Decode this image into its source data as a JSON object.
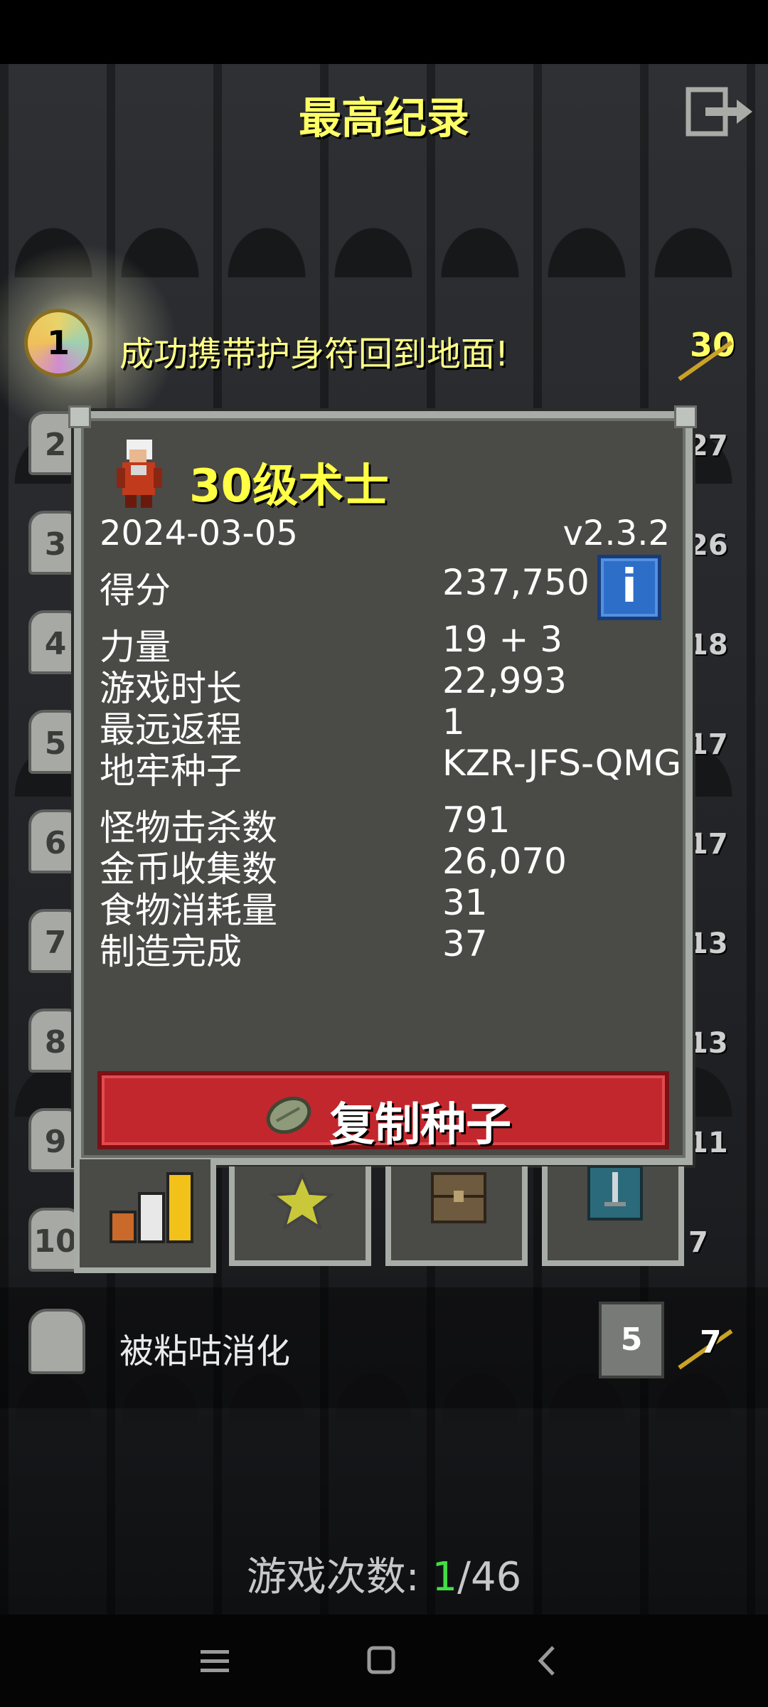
{
  "screen": {
    "title": "最高纪录"
  },
  "records": {
    "first": {
      "rank": "1",
      "description": "成功携带护身符回到地面!",
      "level": "30"
    },
    "ranks": [
      "2",
      "3",
      "4",
      "5",
      "6",
      "7",
      "8",
      "9",
      "10"
    ],
    "levels": [
      "27",
      "26",
      "18",
      "17",
      "17",
      "13",
      "13",
      "11",
      "7"
    ],
    "bottom": {
      "description": "被粘咕消化",
      "depth": "5",
      "level": "7"
    }
  },
  "dialog": {
    "hero_title": "30级术士",
    "date": "2024-03-05",
    "version": "v2.3.2",
    "score_label": "得分",
    "score_value": "237,750",
    "info_icon": "i",
    "stats_group1": [
      {
        "label": "力量",
        "value": "19 + 3"
      },
      {
        "label": "游戏时长",
        "value": "22,993"
      },
      {
        "label": "最远返程",
        "value": "1"
      },
      {
        "label": "地牢种子",
        "value": "KZR-JFS-QMG"
      }
    ],
    "stats_group2": [
      {
        "label": "怪物击杀数",
        "value": "791"
      },
      {
        "label": "金币收集数",
        "value": "26,070"
      },
      {
        "label": "食物消耗量",
        "value": "31"
      },
      {
        "label": "制造完成",
        "value": "37"
      }
    ],
    "copy_seed_label": "复制种子",
    "tabs": [
      "stats-icon",
      "badges-star-icon",
      "inventory-chest-icon",
      "hero-equipment-icon"
    ]
  },
  "footer": {
    "games_label": "游戏次数: ",
    "games_current": "1",
    "games_total": "/46"
  },
  "colors": {
    "title_yellow": "#ffff66",
    "copy_button_red": "#c2272d",
    "info_button_blue": "#2d6ec9",
    "games_current_green": "#44dd44"
  }
}
